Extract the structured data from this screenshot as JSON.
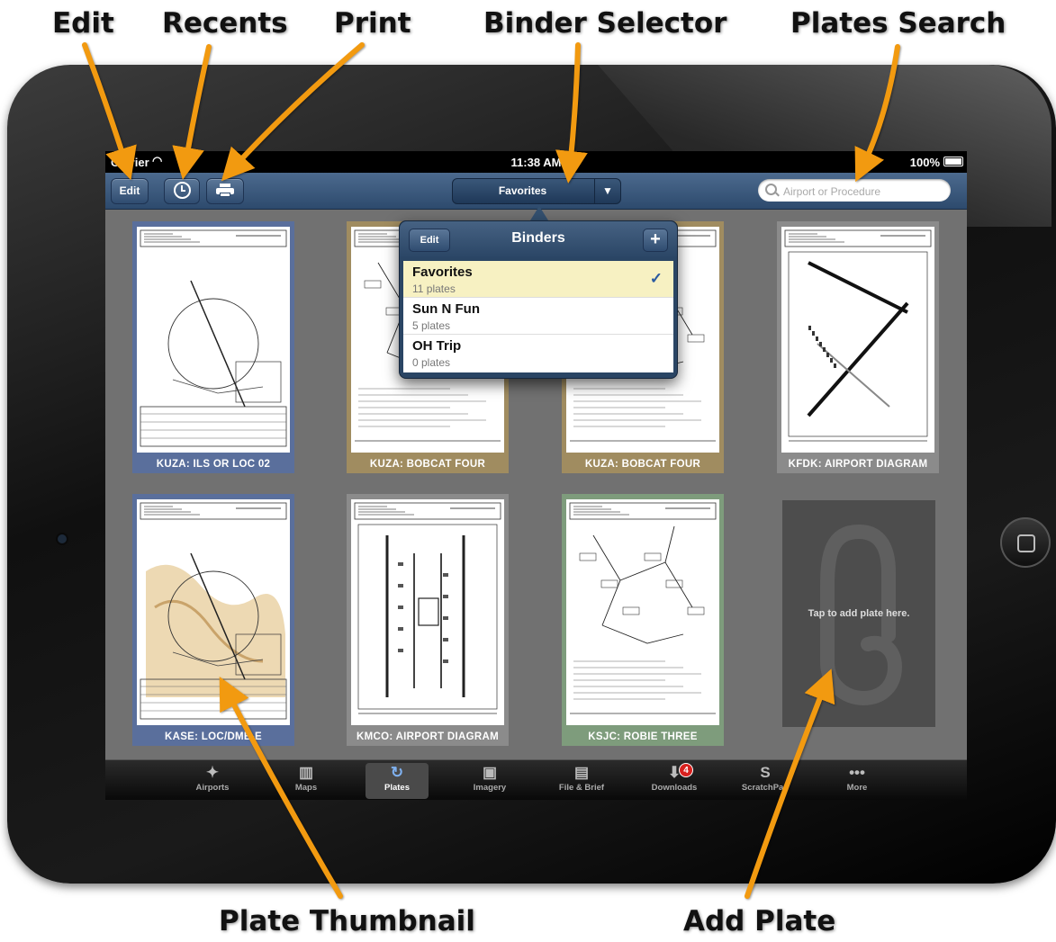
{
  "callouts": {
    "edit": "Edit",
    "recents": "Recents",
    "print": "Print",
    "binder_selector": "Binder Selector",
    "plates_search": "Plates Search",
    "plate_thumbnail": "Plate Thumbnail",
    "add_plate": "Add Plate"
  },
  "status_bar": {
    "carrier": "Carrier",
    "time": "11:38 AM",
    "battery": "100%"
  },
  "toolbar": {
    "edit_label": "Edit",
    "binder_label": "Favorites",
    "search_placeholder": "Airport or Procedure"
  },
  "binders_popover": {
    "title": "Binders",
    "edit_label": "Edit",
    "add_label": "+",
    "items": [
      {
        "name": "Favorites",
        "count": "11 plates",
        "selected": true
      },
      {
        "name": "Sun N Fun",
        "count": "5 plates",
        "selected": false
      },
      {
        "name": "OH Trip",
        "count": "0 plates",
        "selected": false
      }
    ]
  },
  "plates": [
    {
      "caption": "KUZA: ILS OR LOC 02",
      "color": "#5a6f9c",
      "sheet": "approach-color"
    },
    {
      "caption": "KUZA: BOBCAT FOUR",
      "color": "#a08c60",
      "sheet": "departure"
    },
    {
      "caption": "KUZA: BOBCAT FOUR",
      "color": "#a08c60",
      "sheet": "departure"
    },
    {
      "caption": "KFDK: AIRPORT DIAGRAM",
      "color": "#8b8b8b",
      "sheet": "diagram"
    },
    {
      "caption": "KASE: LOC/DME-E",
      "color": "#5a6f9c",
      "sheet": "terrain"
    },
    {
      "caption": "KMCO: AIRPORT DIAGRAM",
      "color": "#8b8b8b",
      "sheet": "diagram2"
    },
    {
      "caption": "KSJC: ROBIE THREE",
      "color": "#7e9c7c",
      "sheet": "departure2"
    }
  ],
  "empty_slot": {
    "text": "Tap to add plate here."
  },
  "tabs": [
    {
      "label": "Airports",
      "icon": "compass-icon",
      "glyph": "✦",
      "active": false
    },
    {
      "label": "Maps",
      "icon": "map-icon",
      "glyph": "▥",
      "active": false
    },
    {
      "label": "Plates",
      "icon": "plates-icon",
      "glyph": "↻",
      "active": true
    },
    {
      "label": "Imagery",
      "icon": "imagery-icon",
      "glyph": "▣",
      "active": false
    },
    {
      "label": "File & Brief",
      "icon": "file-brief-icon",
      "glyph": "▤",
      "active": false
    },
    {
      "label": "Downloads",
      "icon": "download-icon",
      "glyph": "⬇",
      "active": false,
      "badge": "4"
    },
    {
      "label": "ScratchPad",
      "icon": "scratchpad-icon",
      "glyph": "S",
      "active": false
    },
    {
      "label": "More",
      "icon": "more-icon",
      "glyph": "•••",
      "active": false
    }
  ],
  "colors": {
    "accent_arrow": "#f29a10",
    "toolbar": "#2d4a6d",
    "selected_row": "#f7f1c2"
  }
}
